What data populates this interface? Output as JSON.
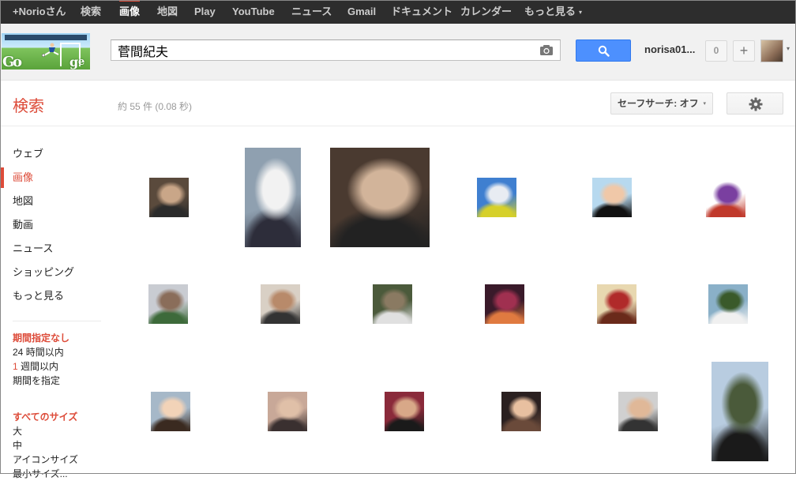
{
  "topbar": {
    "items": [
      {
        "label": "+Norioさん",
        "active": false
      },
      {
        "label": "検索",
        "active": false
      },
      {
        "label": "画像",
        "active": true
      },
      {
        "label": "地図",
        "active": false
      },
      {
        "label": "Play",
        "active": false
      },
      {
        "label": "YouTube",
        "active": false
      },
      {
        "label": "ニュース",
        "active": false
      },
      {
        "label": "Gmail",
        "active": false
      },
      {
        "label": "ドキュメント",
        "active": false
      },
      {
        "label": "カレンダー",
        "active": false
      },
      {
        "label": "もっと見る",
        "active": false
      }
    ],
    "more_caret": "▾"
  },
  "header": {
    "doodle_icon": "soccer-doodle-logo",
    "search": {
      "value": "菅間紀夫",
      "placeholder": ""
    },
    "camera_icon": "camera-icon",
    "search_button_icon": "search-icon",
    "username": "norisa01...",
    "notification_count": "0",
    "share_label": "+",
    "avatar_caret": "▾"
  },
  "subheader": {
    "title": "検索",
    "result_stats": "約 55 件 (0.08 秒)",
    "safesearch_label": "セーフサーチ: オフ",
    "safesearch_caret": "▾",
    "settings_icon": "gear-icon"
  },
  "leftnav": {
    "items": [
      {
        "label": "ウェブ",
        "active": false
      },
      {
        "label": "画像",
        "active": true
      },
      {
        "label": "地図",
        "active": false
      },
      {
        "label": "動画",
        "active": false
      },
      {
        "label": "ニュース",
        "active": false
      },
      {
        "label": "ショッピング",
        "active": false
      },
      {
        "label": "もっと見る",
        "active": false
      }
    ]
  },
  "filters": {
    "time": {
      "heading": "期間指定なし",
      "options": [
        {
          "num": "24",
          "text": " 時間以内"
        },
        {
          "num": "1",
          "text": " 週間以内"
        },
        {
          "num": "",
          "text": "期間を指定"
        }
      ]
    },
    "size": {
      "heading": "すべてのサイズ",
      "options": [
        "大",
        "中",
        "アイコンサイズ",
        "最小サイズ..."
      ]
    }
  },
  "results": [
    {
      "row": 1,
      "col": 1,
      "subject": "man-with-glasses-closeup",
      "colors": [
        "#5a4a3c",
        "#c9a688",
        "#2b2b2b"
      ]
    },
    {
      "row": 1,
      "col": 2,
      "subject": "man-at-desk-with-mug",
      "colors": [
        "#8fa0b0",
        "#f2f2f2",
        "#2d2d3a"
      ]
    },
    {
      "row": 1,
      "col": 3,
      "subject": "man-with-glasses-large",
      "colors": [
        "#4a3a30",
        "#d2b49a",
        "#222222"
      ]
    },
    {
      "row": 1,
      "col": 4,
      "subject": "climber-on-peak",
      "colors": [
        "#3f7fd0",
        "#e8ecf2",
        "#d6d02a"
      ]
    },
    {
      "row": 1,
      "col": 5,
      "subject": "child-in-suit",
      "colors": [
        "#b7d9ef",
        "#f0c8a8",
        "#111111"
      ]
    },
    {
      "row": 1,
      "col": 6,
      "subject": "purple-soccer-jersey",
      "colors": [
        "#ffffff",
        "#7a3fa0",
        "#c0392b"
      ]
    },
    {
      "row": 2,
      "col": 1,
      "subject": "building-with-tree",
      "colors": [
        "#c9ccd2",
        "#8a6d5a",
        "#3d6a3a"
      ]
    },
    {
      "row": 2,
      "col": 2,
      "subject": "man-portrait",
      "colors": [
        "#d9d0c5",
        "#b88a6a",
        "#333333"
      ]
    },
    {
      "row": 2,
      "col": 3,
      "subject": "people-in-forest",
      "colors": [
        "#4b5a3b",
        "#8a7a62",
        "#e0e0e0"
      ]
    },
    {
      "row": 2,
      "col": 4,
      "subject": "stage-performance",
      "colors": [
        "#3a1a2a",
        "#a03050",
        "#e07a40"
      ]
    },
    {
      "row": 2,
      "col": 5,
      "subject": "red-flowers",
      "colors": [
        "#e8d8b0",
        "#b02a2a",
        "#6a2a1a"
      ]
    },
    {
      "row": 2,
      "col": 6,
      "subject": "people-outdoors",
      "colors": [
        "#8ab0c8",
        "#3a5a2a",
        "#f0f0f0"
      ]
    },
    {
      "row": 3,
      "col": 1,
      "subject": "toddler-portrait",
      "colors": [
        "#a6b8c8",
        "#f2d3b8",
        "#3a2a20"
      ]
    },
    {
      "row": 3,
      "col": 2,
      "subject": "older-man-portrait",
      "colors": [
        "#c8a898",
        "#e0c0a8",
        "#3a3030"
      ]
    },
    {
      "row": 3,
      "col": 3,
      "subject": "young-man-red-background",
      "colors": [
        "#8a2a3a",
        "#d8a888",
        "#1a1a1a"
      ]
    },
    {
      "row": 3,
      "col": 4,
      "subject": "two-women-selfie",
      "colors": [
        "#2a2020",
        "#e8c0a0",
        "#6a4a3a"
      ]
    },
    {
      "row": 3,
      "col": 5,
      "subject": "man-with-bandage",
      "colors": [
        "#d0d0d0",
        "#e0b898",
        "#333333"
      ]
    },
    {
      "row": 3,
      "col": 6,
      "subject": "man-on-mountain-view",
      "colors": [
        "#b8cce0",
        "#4a5a3a",
        "#1a1a1a"
      ]
    }
  ]
}
